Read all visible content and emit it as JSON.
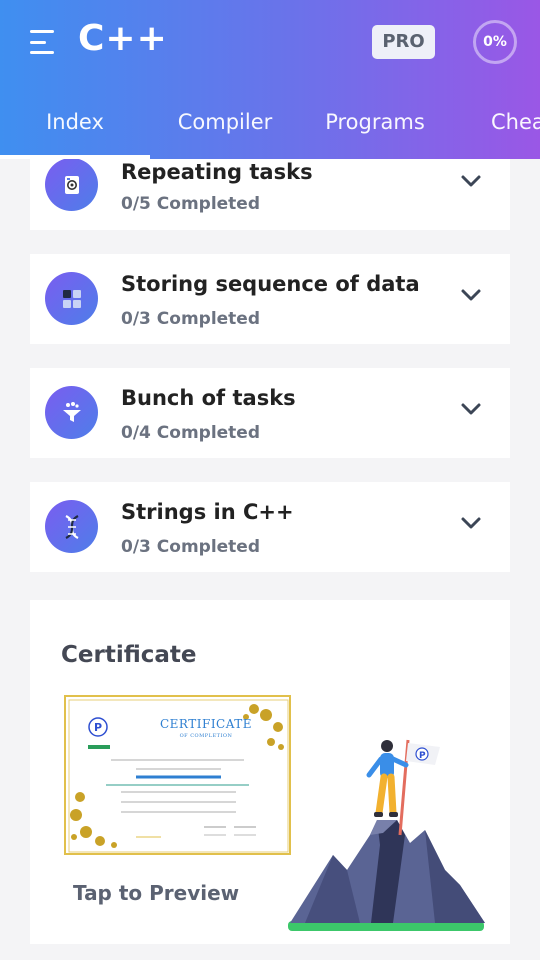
{
  "header": {
    "title": "C++",
    "pro_label": "PRO",
    "progress": "0%",
    "tabs": [
      {
        "label": "Index",
        "active": true
      },
      {
        "label": "Compiler",
        "active": false
      },
      {
        "label": "Programs",
        "active": false
      },
      {
        "label": "Chea",
        "active": false
      }
    ]
  },
  "topics": [
    {
      "title": "Repeating tasks",
      "progress": "0/5 Completed",
      "icon": "loop-icon"
    },
    {
      "title": "Storing sequence of data",
      "progress": "0/3 Completed",
      "icon": "grid-icon"
    },
    {
      "title": "Bunch of tasks",
      "progress": "0/4 Completed",
      "icon": "funnel-icon"
    },
    {
      "title": "Strings in C++",
      "progress": "0/3 Completed",
      "icon": "dna-icon"
    }
  ],
  "certificate": {
    "heading": "Certificate",
    "thumb_title": "CERTIFICATE",
    "thumb_subtitle": "OF COMPLETION",
    "preview_label": "Tap to Preview"
  },
  "colors": {
    "header_gradient_start": "#3f8ff0",
    "header_gradient_end": "#9a57e6",
    "icon_gradient_start": "#7a5df0",
    "icon_gradient_end": "#4e7ee9",
    "cert_accent": "#2e7fd1",
    "cert_border": "#e1c04b"
  }
}
